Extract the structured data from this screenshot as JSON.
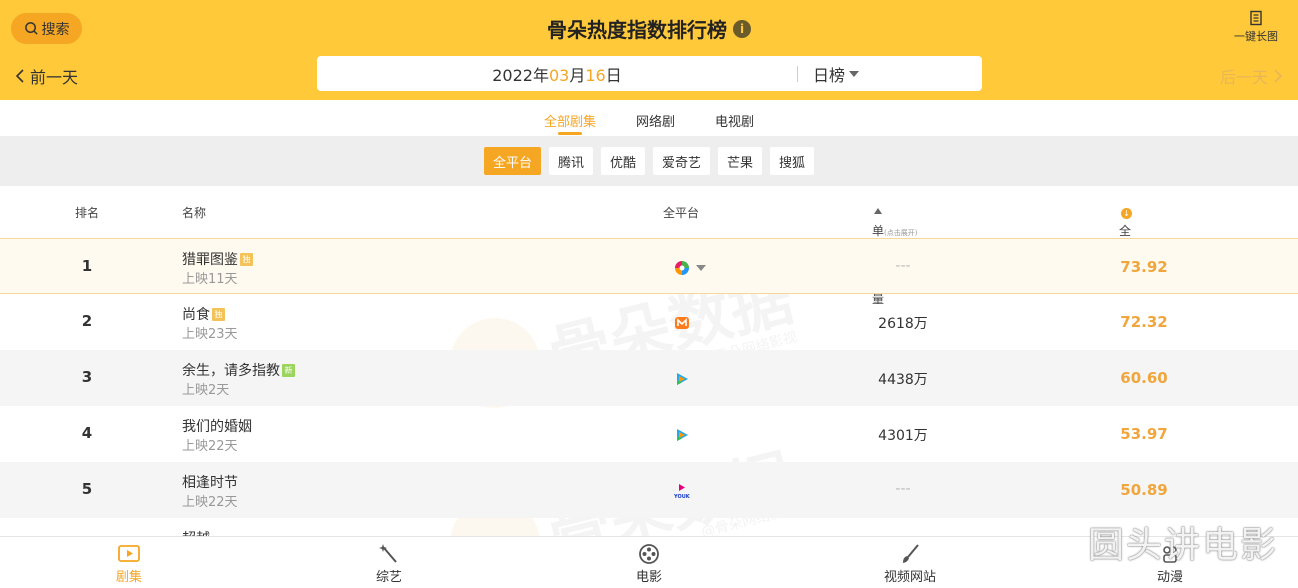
{
  "header": {
    "search_label": "搜索",
    "title": "骨朵热度指数排行榜",
    "info_icon": "i",
    "long_image_label": "一键长图",
    "prev_label": "前一天",
    "next_label": "后一天",
    "date": {
      "year": "2022",
      "year_unit": "年",
      "month": "03",
      "month_unit": "月",
      "day": "16",
      "day_unit": "日"
    },
    "rank_type": "日榜"
  },
  "type_tabs": [
    {
      "label": "全部剧集",
      "active": true
    },
    {
      "label": "网络剧",
      "active": false
    },
    {
      "label": "电视剧",
      "active": false
    }
  ],
  "platforms": [
    {
      "label": "全平台",
      "active": true
    },
    {
      "label": "腾讯",
      "active": false
    },
    {
      "label": "优酷",
      "active": false
    },
    {
      "label": "爱奇艺",
      "active": false
    },
    {
      "label": "芒果",
      "active": false
    },
    {
      "label": "搜狐",
      "active": false
    }
  ],
  "columns": {
    "rank": "排名",
    "name": "名称",
    "platform": "全平台",
    "plays": "单日播放量",
    "plays_hint": "(点击展开)",
    "heat": "全网热度"
  },
  "rows": [
    {
      "rank": "1",
      "name": "猎罪图鉴",
      "badge": "独",
      "badge_color": "#f3c258",
      "sub": "上映11天",
      "platform_icon": "multi-platform-icon",
      "plays": "---",
      "heat": "73.92"
    },
    {
      "rank": "2",
      "name": "尚食",
      "badge": "独",
      "badge_color": "#f3c258",
      "sub": "上映23天",
      "platform_icon": "mango-icon",
      "plays": "2618万",
      "heat": "72.32"
    },
    {
      "rank": "3",
      "name": "余生，请多指教",
      "badge": "新",
      "badge_color": "#9bd55d",
      "sub": "上映2天",
      "platform_icon": "tencent-icon",
      "plays": "4438万",
      "heat": "60.60"
    },
    {
      "rank": "4",
      "name": "我们的婚姻",
      "badge": "",
      "badge_color": "",
      "sub": "上映22天",
      "platform_icon": "tencent-icon",
      "plays": "4301万",
      "heat": "53.97"
    },
    {
      "rank": "5",
      "name": "相逢时节",
      "badge": "",
      "badge_color": "",
      "sub": "上映22天",
      "platform_icon": "youku-icon",
      "plays": "---",
      "heat": "50.89"
    },
    {
      "rank": "",
      "name": "超越",
      "badge": "",
      "badge_color": "",
      "sub": "",
      "platform_icon": "",
      "plays": "",
      "heat": ""
    }
  ],
  "watermark": {
    "text": "骨朵数据",
    "sub": "@骨朵网络影视"
  },
  "bottom_nav": [
    {
      "label": "剧集",
      "icon": "play-icon",
      "active": true
    },
    {
      "label": "综艺",
      "icon": "magic-wand-icon",
      "active": false
    },
    {
      "label": "电影",
      "icon": "film-reel-icon",
      "active": false
    },
    {
      "label": "视频网站",
      "icon": "brush-icon",
      "active": false
    },
    {
      "label": "动漫",
      "icon": "anime-icon",
      "active": false
    }
  ],
  "corner_watermark": "圆头讲电影",
  "colors": {
    "brand_yellow": "#ffc93a",
    "accent_orange": "#f5a623",
    "heat_orange": "#f0a63c"
  }
}
